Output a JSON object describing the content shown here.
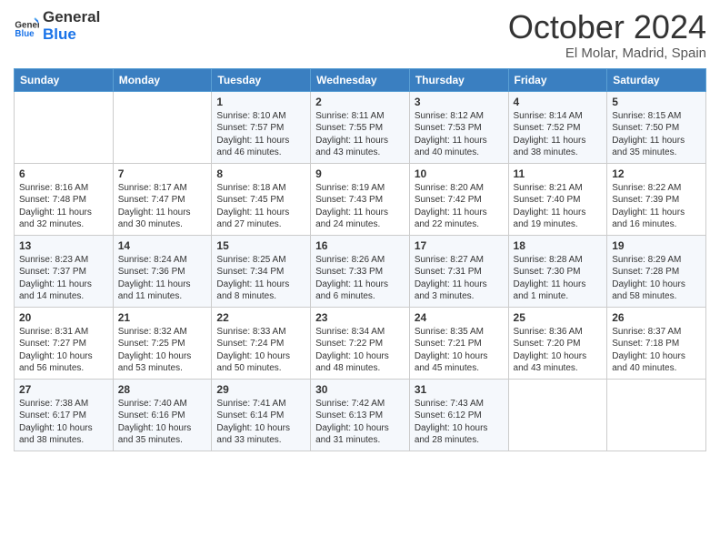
{
  "header": {
    "logo_line1": "General",
    "logo_line2": "Blue",
    "calendar_title": "October 2024",
    "calendar_subtitle": "El Molar, Madrid, Spain"
  },
  "days_of_week": [
    "Sunday",
    "Monday",
    "Tuesday",
    "Wednesday",
    "Thursday",
    "Friday",
    "Saturday"
  ],
  "weeks": [
    [
      {
        "day": "",
        "info": ""
      },
      {
        "day": "",
        "info": ""
      },
      {
        "day": "1",
        "info": "Sunrise: 8:10 AM\nSunset: 7:57 PM\nDaylight: 11 hours and 46 minutes."
      },
      {
        "day": "2",
        "info": "Sunrise: 8:11 AM\nSunset: 7:55 PM\nDaylight: 11 hours and 43 minutes."
      },
      {
        "day": "3",
        "info": "Sunrise: 8:12 AM\nSunset: 7:53 PM\nDaylight: 11 hours and 40 minutes."
      },
      {
        "day": "4",
        "info": "Sunrise: 8:14 AM\nSunset: 7:52 PM\nDaylight: 11 hours and 38 minutes."
      },
      {
        "day": "5",
        "info": "Sunrise: 8:15 AM\nSunset: 7:50 PM\nDaylight: 11 hours and 35 minutes."
      }
    ],
    [
      {
        "day": "6",
        "info": "Sunrise: 8:16 AM\nSunset: 7:48 PM\nDaylight: 11 hours and 32 minutes."
      },
      {
        "day": "7",
        "info": "Sunrise: 8:17 AM\nSunset: 7:47 PM\nDaylight: 11 hours and 30 minutes."
      },
      {
        "day": "8",
        "info": "Sunrise: 8:18 AM\nSunset: 7:45 PM\nDaylight: 11 hours and 27 minutes."
      },
      {
        "day": "9",
        "info": "Sunrise: 8:19 AM\nSunset: 7:43 PM\nDaylight: 11 hours and 24 minutes."
      },
      {
        "day": "10",
        "info": "Sunrise: 8:20 AM\nSunset: 7:42 PM\nDaylight: 11 hours and 22 minutes."
      },
      {
        "day": "11",
        "info": "Sunrise: 8:21 AM\nSunset: 7:40 PM\nDaylight: 11 hours and 19 minutes."
      },
      {
        "day": "12",
        "info": "Sunrise: 8:22 AM\nSunset: 7:39 PM\nDaylight: 11 hours and 16 minutes."
      }
    ],
    [
      {
        "day": "13",
        "info": "Sunrise: 8:23 AM\nSunset: 7:37 PM\nDaylight: 11 hours and 14 minutes."
      },
      {
        "day": "14",
        "info": "Sunrise: 8:24 AM\nSunset: 7:36 PM\nDaylight: 11 hours and 11 minutes."
      },
      {
        "day": "15",
        "info": "Sunrise: 8:25 AM\nSunset: 7:34 PM\nDaylight: 11 hours and 8 minutes."
      },
      {
        "day": "16",
        "info": "Sunrise: 8:26 AM\nSunset: 7:33 PM\nDaylight: 11 hours and 6 minutes."
      },
      {
        "day": "17",
        "info": "Sunrise: 8:27 AM\nSunset: 7:31 PM\nDaylight: 11 hours and 3 minutes."
      },
      {
        "day": "18",
        "info": "Sunrise: 8:28 AM\nSunset: 7:30 PM\nDaylight: 11 hours and 1 minute."
      },
      {
        "day": "19",
        "info": "Sunrise: 8:29 AM\nSunset: 7:28 PM\nDaylight: 10 hours and 58 minutes."
      }
    ],
    [
      {
        "day": "20",
        "info": "Sunrise: 8:31 AM\nSunset: 7:27 PM\nDaylight: 10 hours and 56 minutes."
      },
      {
        "day": "21",
        "info": "Sunrise: 8:32 AM\nSunset: 7:25 PM\nDaylight: 10 hours and 53 minutes."
      },
      {
        "day": "22",
        "info": "Sunrise: 8:33 AM\nSunset: 7:24 PM\nDaylight: 10 hours and 50 minutes."
      },
      {
        "day": "23",
        "info": "Sunrise: 8:34 AM\nSunset: 7:22 PM\nDaylight: 10 hours and 48 minutes."
      },
      {
        "day": "24",
        "info": "Sunrise: 8:35 AM\nSunset: 7:21 PM\nDaylight: 10 hours and 45 minutes."
      },
      {
        "day": "25",
        "info": "Sunrise: 8:36 AM\nSunset: 7:20 PM\nDaylight: 10 hours and 43 minutes."
      },
      {
        "day": "26",
        "info": "Sunrise: 8:37 AM\nSunset: 7:18 PM\nDaylight: 10 hours and 40 minutes."
      }
    ],
    [
      {
        "day": "27",
        "info": "Sunrise: 7:38 AM\nSunset: 6:17 PM\nDaylight: 10 hours and 38 minutes."
      },
      {
        "day": "28",
        "info": "Sunrise: 7:40 AM\nSunset: 6:16 PM\nDaylight: 10 hours and 35 minutes."
      },
      {
        "day": "29",
        "info": "Sunrise: 7:41 AM\nSunset: 6:14 PM\nDaylight: 10 hours and 33 minutes."
      },
      {
        "day": "30",
        "info": "Sunrise: 7:42 AM\nSunset: 6:13 PM\nDaylight: 10 hours and 31 minutes."
      },
      {
        "day": "31",
        "info": "Sunrise: 7:43 AM\nSunset: 6:12 PM\nDaylight: 10 hours and 28 minutes."
      },
      {
        "day": "",
        "info": ""
      },
      {
        "day": "",
        "info": ""
      }
    ]
  ]
}
